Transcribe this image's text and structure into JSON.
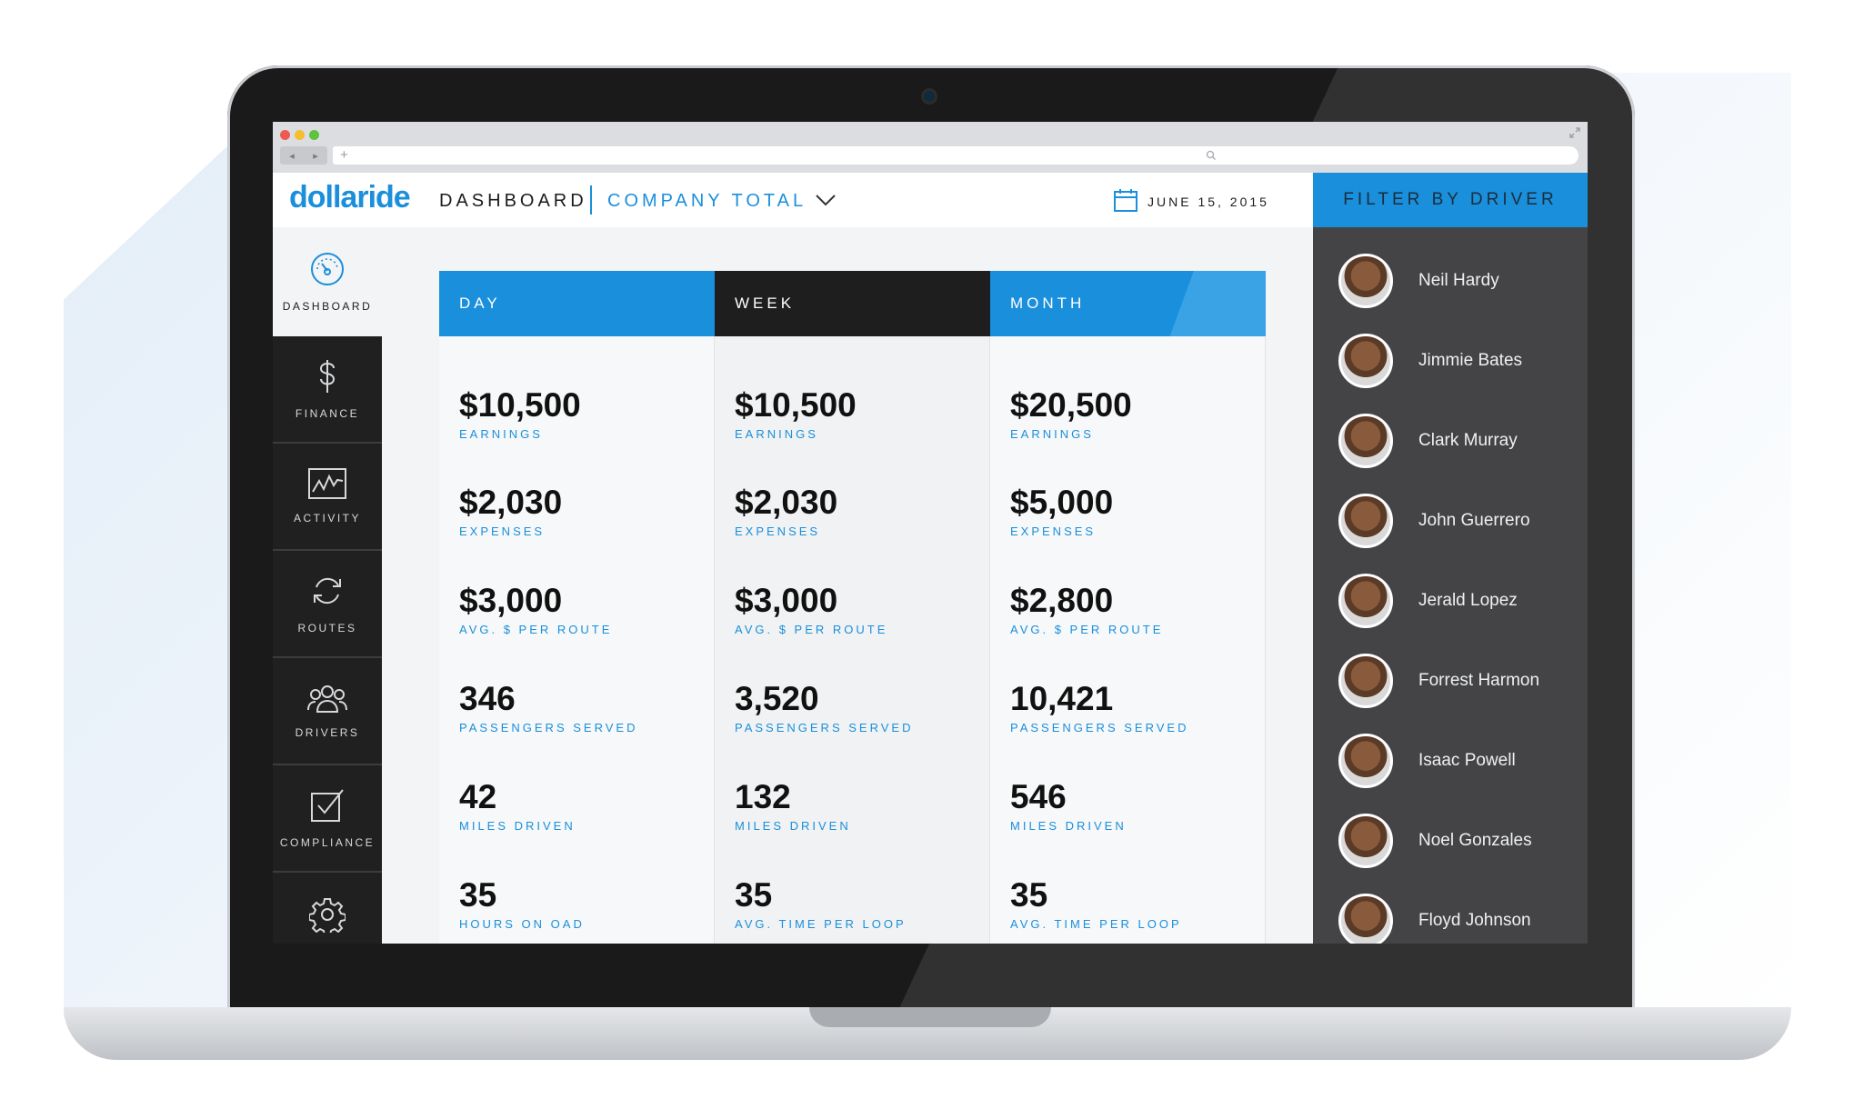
{
  "browser": {
    "nav_back": "◂",
    "nav_forward": "▸",
    "new_tab": "+",
    "search_icon": "search-icon",
    "expand_icon": "expand-icon"
  },
  "header": {
    "logo": "dollaride",
    "title": "DASHBOARD",
    "company": "COMPANY TOTAL",
    "date": "JUNE 15, 2015"
  },
  "sidebar": {
    "items": [
      {
        "label": "DASHBOARD",
        "icon": "gauge-icon"
      },
      {
        "label": "FINANCE",
        "icon": "dollar-icon"
      },
      {
        "label": "ACTIVITY",
        "icon": "chart-icon"
      },
      {
        "label": "ROUTES",
        "icon": "refresh-icon"
      },
      {
        "label": "DRIVERS",
        "icon": "people-icon"
      },
      {
        "label": "COMPLIANCE",
        "icon": "checkbox-icon"
      },
      {
        "label": "",
        "icon": "gear-icon"
      }
    ]
  },
  "columns": [
    {
      "header": "DAY",
      "stats": [
        {
          "value": "$10,500",
          "label": "EARNINGS"
        },
        {
          "value": "$2,030",
          "label": "EXPENSES"
        },
        {
          "value": "$3,000",
          "label": "AVG. $ PER ROUTE"
        },
        {
          "value": "346",
          "label": "PASSENGERS SERVED"
        },
        {
          "value": "42",
          "label": "MILES DRIVEN"
        },
        {
          "value": "35",
          "label": "HOURS ON OAD"
        }
      ]
    },
    {
      "header": "WEEK",
      "stats": [
        {
          "value": "$10,500",
          "label": "EARNINGS"
        },
        {
          "value": "$2,030",
          "label": "EXPENSES"
        },
        {
          "value": "$3,000",
          "label": "AVG. $ PER ROUTE"
        },
        {
          "value": "3,520",
          "label": "PASSENGERS SERVED"
        },
        {
          "value": "132",
          "label": "MILES DRIVEN"
        },
        {
          "value": "35",
          "label": "AVG. TIME PER LOOP"
        }
      ]
    },
    {
      "header": "MONTH",
      "stats": [
        {
          "value": "$20,500",
          "label": "EARNINGS"
        },
        {
          "value": "$5,000",
          "label": "EXPENSES"
        },
        {
          "value": "$2,800",
          "label": "AVG. $ PER ROUTE"
        },
        {
          "value": "10,421",
          "label": "PASSENGERS SERVED"
        },
        {
          "value": "546",
          "label": "MILES DRIVEN"
        },
        {
          "value": "35",
          "label": "AVG. TIME PER LOOP"
        }
      ]
    }
  ],
  "filter": {
    "title": "FILTER BY DRIVER",
    "drivers": [
      "Neil Hardy",
      "Jimmie Bates",
      "Clark Murray",
      "John Guerrero",
      "Jerald Lopez",
      "Forrest Harmon",
      "Isaac Powell",
      "Noel Gonzales",
      "Floyd Johnson"
    ]
  },
  "colors": {
    "accent": "#1a8fdc",
    "header_dark": "#1e1e1f",
    "sidebar": "#202021",
    "panel": "#444446"
  }
}
